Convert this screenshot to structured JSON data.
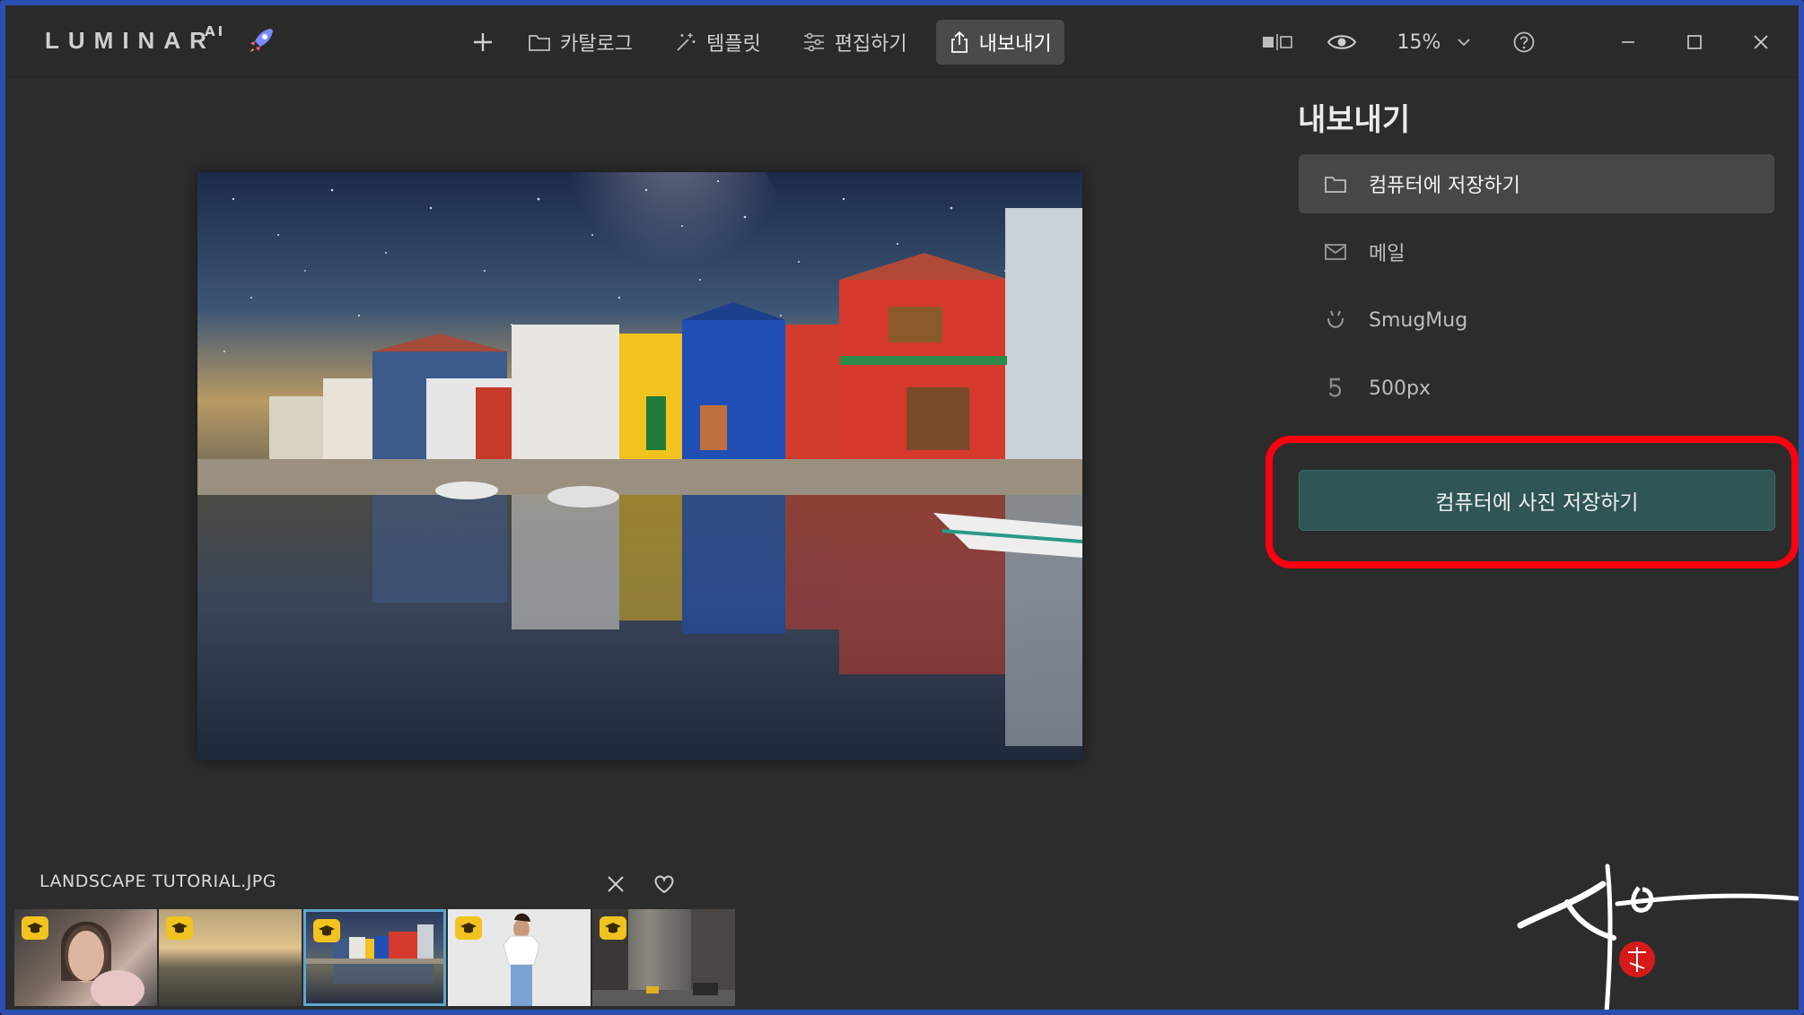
{
  "app": {
    "logo_text": "LUMINAR",
    "logo_sup": "AI"
  },
  "nav": {
    "items": [
      {
        "label": "카탈로그",
        "icon": "folder-icon"
      },
      {
        "label": "템플릿",
        "icon": "sparkle-icon"
      },
      {
        "label": "편집하기",
        "icon": "sliders-icon"
      },
      {
        "label": "내보내기",
        "icon": "share-icon",
        "active": true
      }
    ]
  },
  "toolbar": {
    "zoom": "15%"
  },
  "panel": {
    "title": "내보내기",
    "options": [
      {
        "label": "컴퓨터에 저장하기",
        "icon": "folder-icon",
        "selected": true
      },
      {
        "label": "메일",
        "icon": "mail-icon"
      },
      {
        "label": "SmugMug",
        "icon": "smugmug-icon"
      },
      {
        "label": "500px",
        "icon": "500px-icon"
      }
    ],
    "export_button": "컴퓨터에 사진 저장하기"
  },
  "filmstrip": {
    "filename": "LANDSCAPE TUTORIAL.JPG",
    "selected_index": 2
  },
  "colors": {
    "accent_button": "#2f5555",
    "highlight": "#ff0010",
    "selection": "#5aa7d0",
    "badge": "#f2c31f"
  }
}
